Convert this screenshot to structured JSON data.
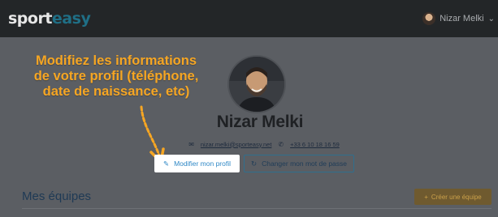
{
  "header": {
    "logo_part1": "sport",
    "logo_part2": "easy",
    "user_name": "Nizar Melki"
  },
  "tooltip": {
    "line1": "Modifiez les informations",
    "line2": "de votre profil (téléphone,",
    "line3": "date de naissance, etc)"
  },
  "profile": {
    "name": "Nizar Melki",
    "email": "nizar.melki@sporteasy.net",
    "phone": "+33 6 10 18 16 59"
  },
  "actions": {
    "edit_label": "Modifier mon profil",
    "password_label": "Changer mon mot de passe"
  },
  "teams": {
    "title": "Mes équipes",
    "create_label": "Créer une équipe"
  },
  "colors": {
    "accent": "#f6a623",
    "link": "#2f88c6"
  }
}
